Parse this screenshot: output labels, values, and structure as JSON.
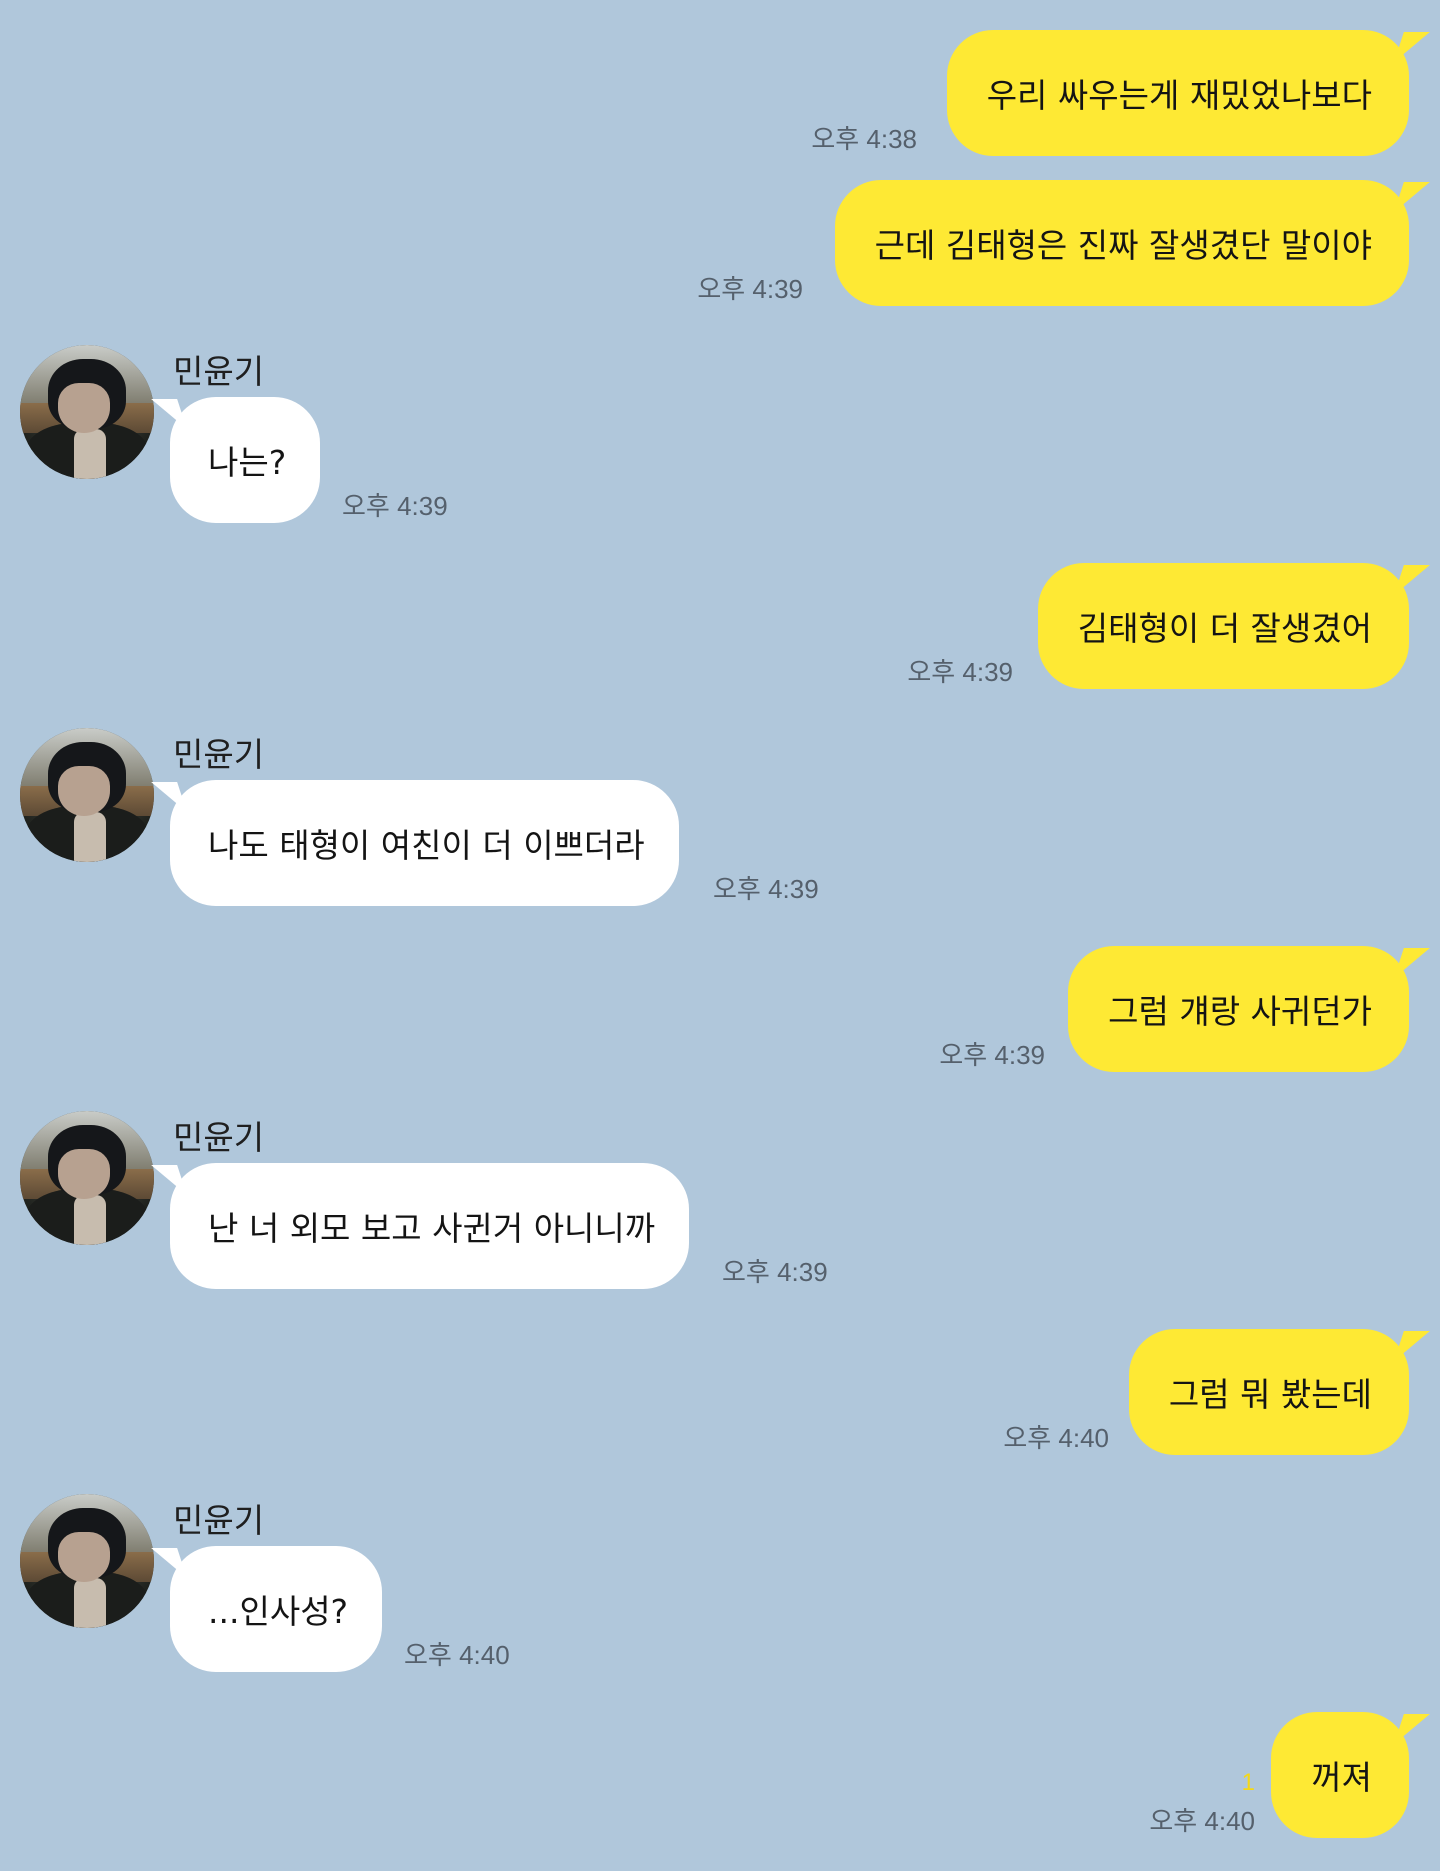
{
  "chat": {
    "background_color": "#b0c7db",
    "my_bubble_color": "#fee934",
    "their_bubble_color": "#ffffff",
    "messages": [
      {
        "from": "me",
        "text": "우리 싸우는게 재밌었나보다",
        "time": "오후 4:38"
      },
      {
        "from": "me",
        "text": "근데 김태형은 진짜 잘생겼단 말이야",
        "time": "오후 4:39"
      },
      {
        "from": "them",
        "sender": "민윤기",
        "text": "나는?",
        "time": "오후 4:39"
      },
      {
        "from": "me",
        "text": "김태형이 더 잘생겼어",
        "time": "오후 4:39"
      },
      {
        "from": "them",
        "sender": "민윤기",
        "text": "나도 태형이 여친이 더 이쁘더라",
        "time": "오후 4:39"
      },
      {
        "from": "me",
        "text": "그럼 걔랑 사귀던가",
        "time": "오후 4:39"
      },
      {
        "from": "them",
        "sender": "민윤기",
        "text": "난 너 외모 보고 사귄거 아니니까",
        "time": "오후 4:39"
      },
      {
        "from": "me",
        "text": "그럼 뭐 봤는데",
        "time": "오후 4:40"
      },
      {
        "from": "them",
        "sender": "민윤기",
        "text": "...인사성?",
        "time": "오후 4:40"
      },
      {
        "from": "me",
        "text": "꺼져",
        "time": "오후 4:40",
        "unread": "1"
      }
    ]
  }
}
